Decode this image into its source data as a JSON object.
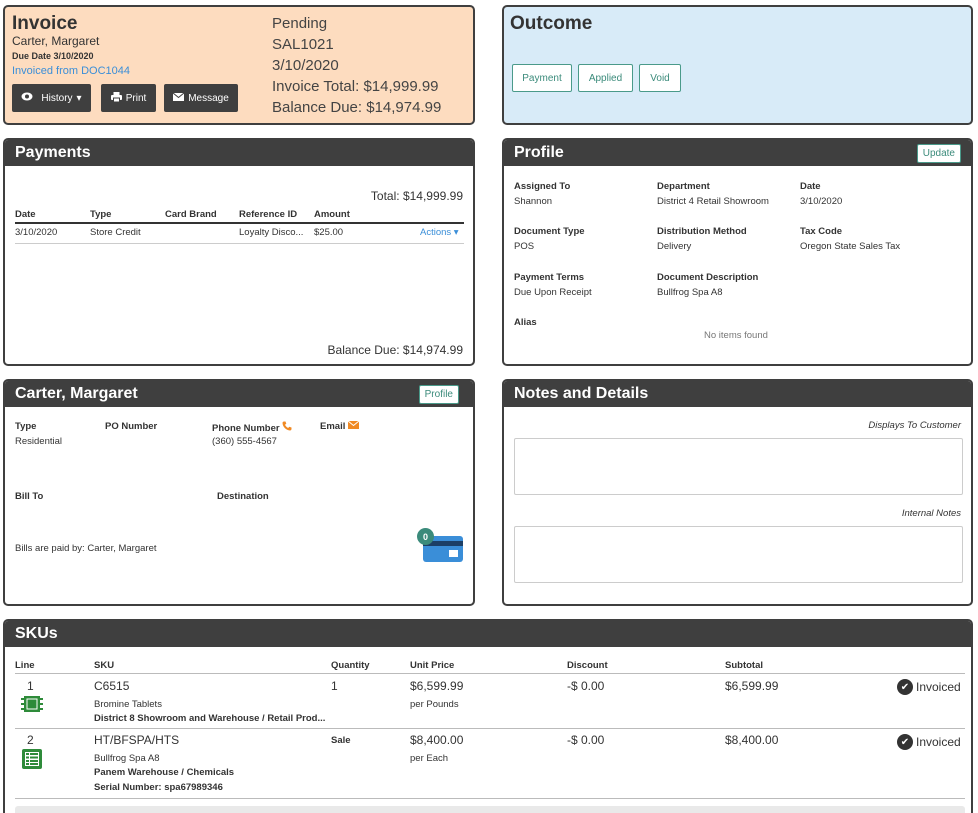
{
  "invoice": {
    "title": "Invoice",
    "customer_name": "Carter, Margaret",
    "due_date": "Due Date 3/10/2020",
    "invoiced_from": "Invoiced from DOC1044",
    "status": "Pending",
    "number": "SAL1021",
    "date": "3/10/2020",
    "total": "Invoice Total: $14,999.99",
    "balance_due": "Balance Due: $14,974.99",
    "buttons": {
      "history": "History",
      "print": "Print",
      "message": "Message"
    }
  },
  "outcome": {
    "title": "Outcome",
    "buttons": {
      "payment": "Payment",
      "applied": "Applied",
      "void": "Void"
    }
  },
  "payments": {
    "title": "Payments",
    "total": "Total: $14,999.99",
    "columns": [
      "Date",
      "Type",
      "Card Brand",
      "Reference ID",
      "Amount"
    ],
    "rows": [
      {
        "date": "3/10/2020",
        "type": "Store Credit",
        "card_brand": "",
        "reference_id": "Loyalty Disco...",
        "amount": "$25.00",
        "actions": "Actions"
      }
    ],
    "balance_due": "Balance Due: $14,974.99"
  },
  "profile": {
    "title": "Profile",
    "update_label": "Update",
    "fields": {
      "assigned_to": {
        "label": "Assigned To",
        "value": "Shannon"
      },
      "department": {
        "label": "Department",
        "value": "District 4 Retail Showroom"
      },
      "date": {
        "label": "Date",
        "value": "3/10/2020"
      },
      "document_type": {
        "label": "Document Type",
        "value": "POS"
      },
      "distribution_method": {
        "label": "Distribution Method",
        "value": "Delivery"
      },
      "tax_code": {
        "label": "Tax Code",
        "value": "Oregon State Sales Tax"
      },
      "payment_terms": {
        "label": "Payment Terms",
        "value": "Due Upon Receipt"
      },
      "document_description": {
        "label": "Document Description",
        "value": "Bullfrog Spa A8"
      },
      "alias": {
        "label": "Alias",
        "value": "No items found"
      }
    }
  },
  "customer": {
    "title": "Carter, Margaret",
    "profile_label": "Profile",
    "type_label": "Type",
    "type_value": "Residential",
    "po_label": "PO Number",
    "phone_label": "Phone Number",
    "phone_value": "(360) 555-4567",
    "email_label": "Email",
    "bill_to_label": "Bill To",
    "destination_label": "Destination",
    "bills_paid_by": "Bills are paid by: Carter, Margaret",
    "card_count": "0",
    "icons": {
      "phone": "phone-icon",
      "email": "envelope-icon",
      "card": "credit-card-icon"
    },
    "accent_color": "#f08a24"
  },
  "notes": {
    "title": "Notes and Details",
    "customer_caption": "Displays To Customer",
    "internal_caption": "Internal Notes"
  },
  "skus": {
    "title": "SKUs",
    "columns": [
      "Line",
      "SKU",
      "Quantity",
      "Unit Price",
      "Discount",
      "Subtotal"
    ],
    "rows": [
      {
        "line": "1",
        "sku": "C6515",
        "description": "Bromine Tablets",
        "location": "District 8 Showroom and Warehouse / Retail Prod...",
        "serial": "",
        "quantity": "1",
        "unit_price": "$6,599.99",
        "unit": "per Pounds",
        "discount": "-$ 0.00",
        "subtotal": "$6,599.99",
        "status": "Invoiced"
      },
      {
        "line": "2",
        "sku": "HT/BFSPA/HTS",
        "description": "Bullfrog Spa A8",
        "location": "Panem Warehouse / Chemicals",
        "serial": "Serial Number: spa67989346",
        "quantity": "Sale",
        "unit_price": "$8,400.00",
        "unit": "per Each",
        "discount": "-$ 0.00",
        "subtotal": "$8,400.00",
        "status": "Invoiced"
      }
    ]
  },
  "colors": {
    "invoice_bg": "#fddcbf",
    "outcome_bg": "#d8ebf8",
    "header_dark": "#3f3f3f",
    "teal": "#3b8b7b",
    "link_blue": "#3a8ed8",
    "sku_icon_green": "#2e8b3a"
  }
}
